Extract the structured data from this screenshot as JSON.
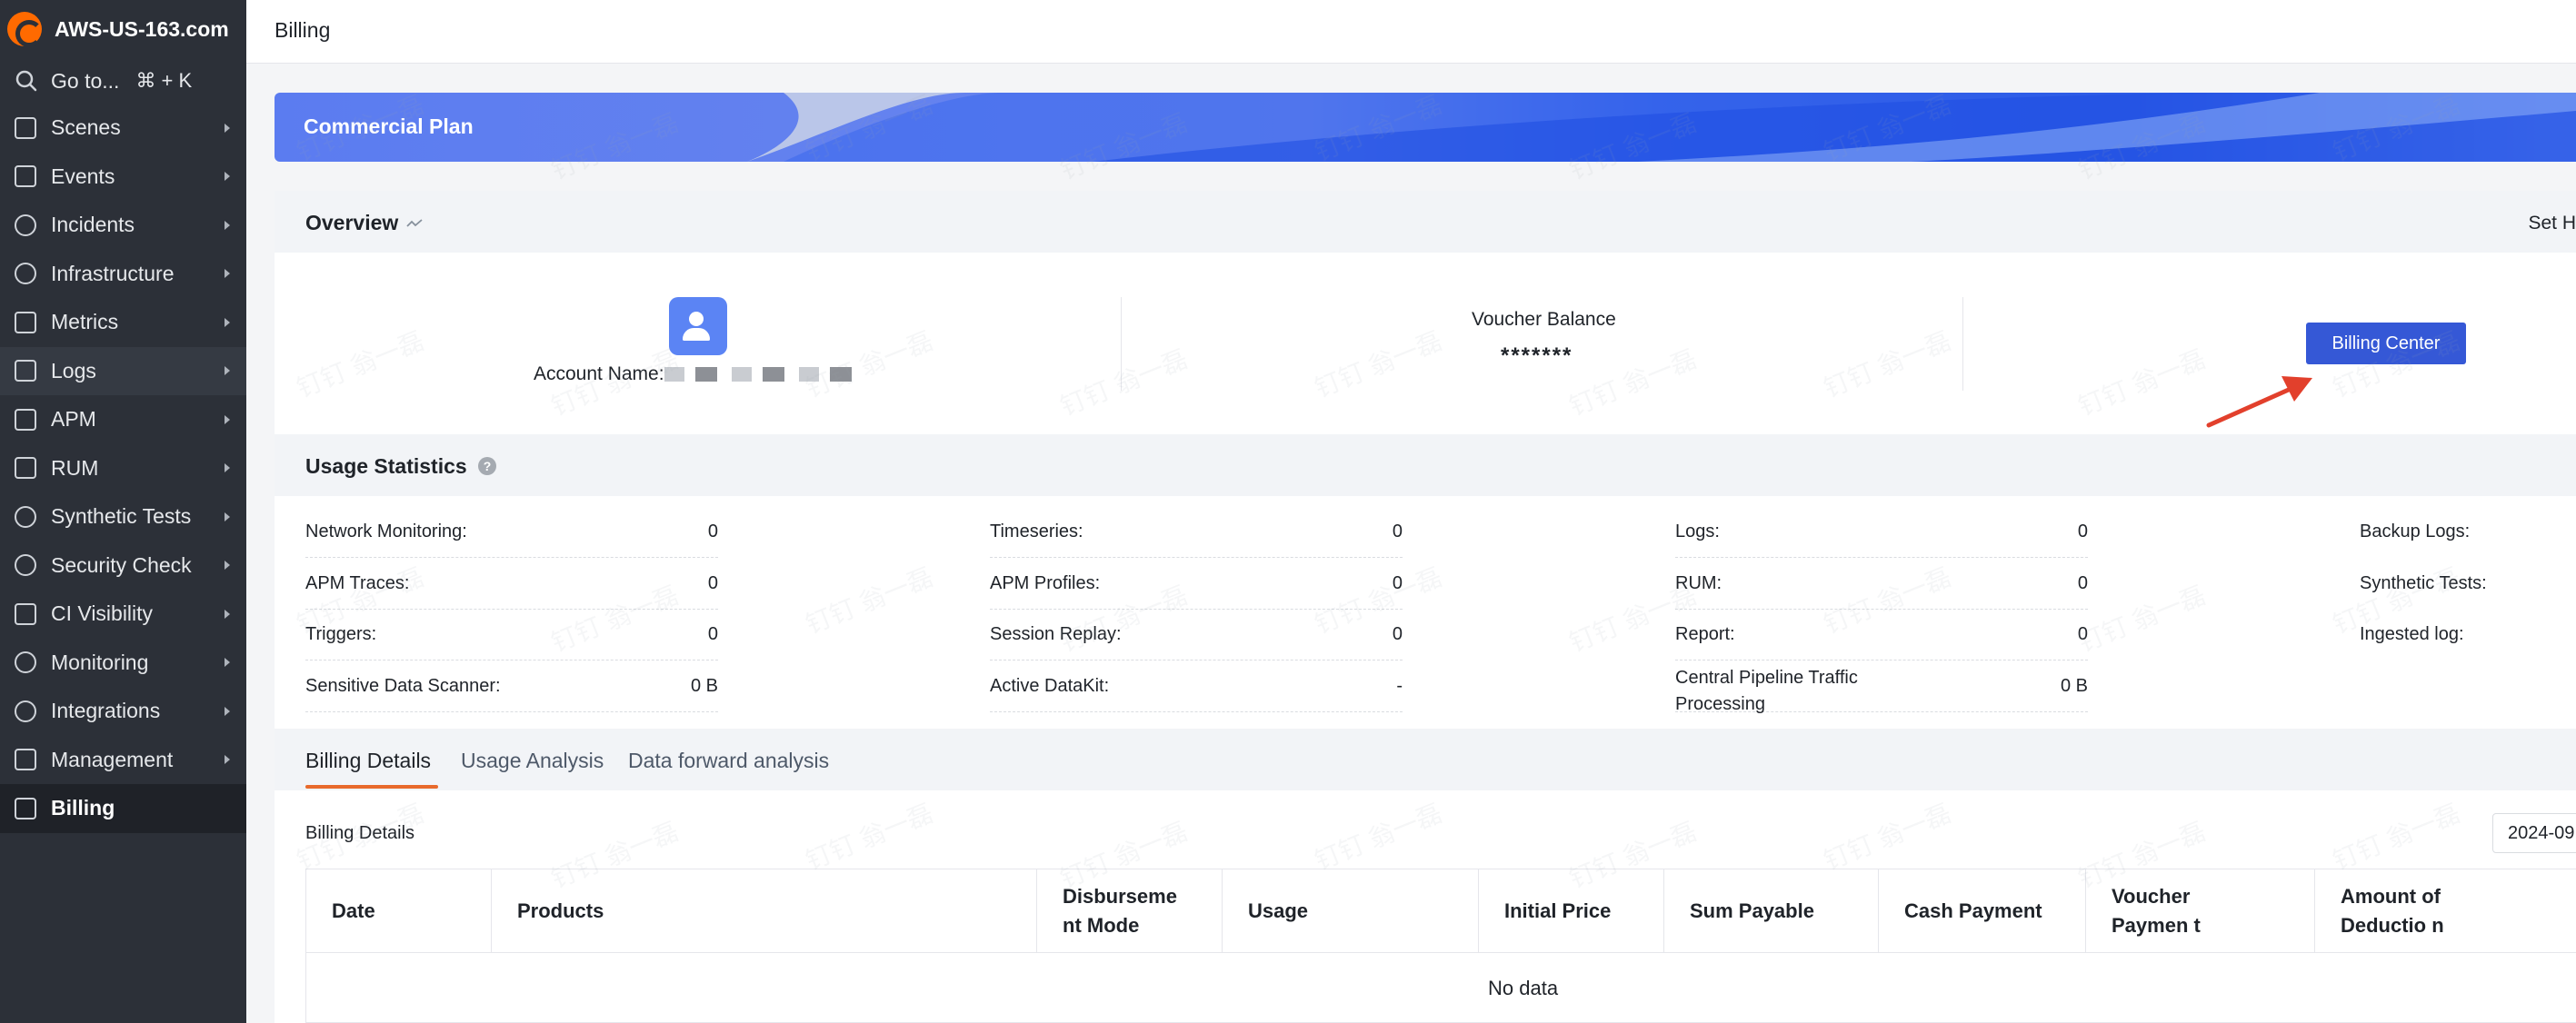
{
  "app": {
    "brand": "AWS-US-163.com",
    "goto_label": "Go to...",
    "goto_shortcut": "⌘ + K"
  },
  "sidebar": {
    "items": [
      {
        "label": "Scenes",
        "icon": "scenes-icon"
      },
      {
        "label": "Events",
        "icon": "events-icon"
      },
      {
        "label": "Incidents",
        "icon": "incidents-icon"
      },
      {
        "label": "Infrastructure",
        "icon": "infrastructure-icon"
      },
      {
        "label": "Metrics",
        "icon": "metrics-icon"
      },
      {
        "label": "Logs",
        "icon": "logs-icon"
      },
      {
        "label": "APM",
        "icon": "apm-icon"
      },
      {
        "label": "RUM",
        "icon": "rum-icon"
      },
      {
        "label": "Synthetic Tests",
        "icon": "synthetic-tests-icon"
      },
      {
        "label": "Security Check",
        "icon": "security-check-icon"
      },
      {
        "label": "CI Visibility",
        "icon": "ci-visibility-icon"
      },
      {
        "label": "Monitoring",
        "icon": "monitoring-icon"
      },
      {
        "label": "Integrations",
        "icon": "integrations-icon"
      },
      {
        "label": "Management",
        "icon": "management-icon"
      },
      {
        "label": "Billing",
        "icon": "billing-icon"
      }
    ],
    "active": "Billing",
    "highlighted": "Logs"
  },
  "header": {
    "title": "Billing"
  },
  "banner": {
    "title": "Commercial Plan"
  },
  "overview": {
    "title": "Overview",
    "set_label": "Set H",
    "account_label": "Account Name:",
    "voucher_label": "Voucher Balance",
    "voucher_value": "*******",
    "billing_center_button": "Billing Center"
  },
  "usage": {
    "title": "Usage Statistics",
    "help": "?",
    "stats": [
      {
        "label": "Network Monitoring:",
        "value": "0"
      },
      {
        "label": "APM Traces:",
        "value": "0"
      },
      {
        "label": "Triggers:",
        "value": "0"
      },
      {
        "label": "Sensitive Data Scanner:",
        "value": "0 B"
      },
      {
        "label": "Timeseries:",
        "value": "0"
      },
      {
        "label": "APM Profiles:",
        "value": "0"
      },
      {
        "label": "Session Replay:",
        "value": "0"
      },
      {
        "label": "Active DataKit:",
        "value": "-"
      },
      {
        "label": "Logs:",
        "value": "0"
      },
      {
        "label": "RUM:",
        "value": "0"
      },
      {
        "label": "Report:",
        "value": "0"
      },
      {
        "label": "Central Pipeline Traffic Processing",
        "value": "0 B"
      },
      {
        "label": "Backup Logs:",
        "value": ""
      },
      {
        "label": "Synthetic Tests:",
        "value": ""
      },
      {
        "label": "Ingested log:",
        "value": ""
      }
    ]
  },
  "tabs": [
    {
      "label": "Billing Details",
      "active": true
    },
    {
      "label": "Usage Analysis",
      "active": false
    },
    {
      "label": "Data forward analysis",
      "active": false
    }
  ],
  "billing_details": {
    "label": "Billing Details",
    "date_value": "2024-09",
    "columns": [
      "Date",
      "Products",
      "Disburseme nt Mode",
      "Usage",
      "Initial Price",
      "Sum Payable",
      "Cash Payment",
      "Voucher Paymen t",
      "Amount of Deductio n"
    ],
    "empty_text": "No data"
  },
  "watermark_text": "钉钉 翁一磊",
  "colors": {
    "sidebar_bg": "#2c3038",
    "brand_orange": "#ff6a00",
    "primary_button": "#3558d6",
    "tab_underline": "#e86a2c",
    "annotation_arrow": "#e2402c"
  }
}
